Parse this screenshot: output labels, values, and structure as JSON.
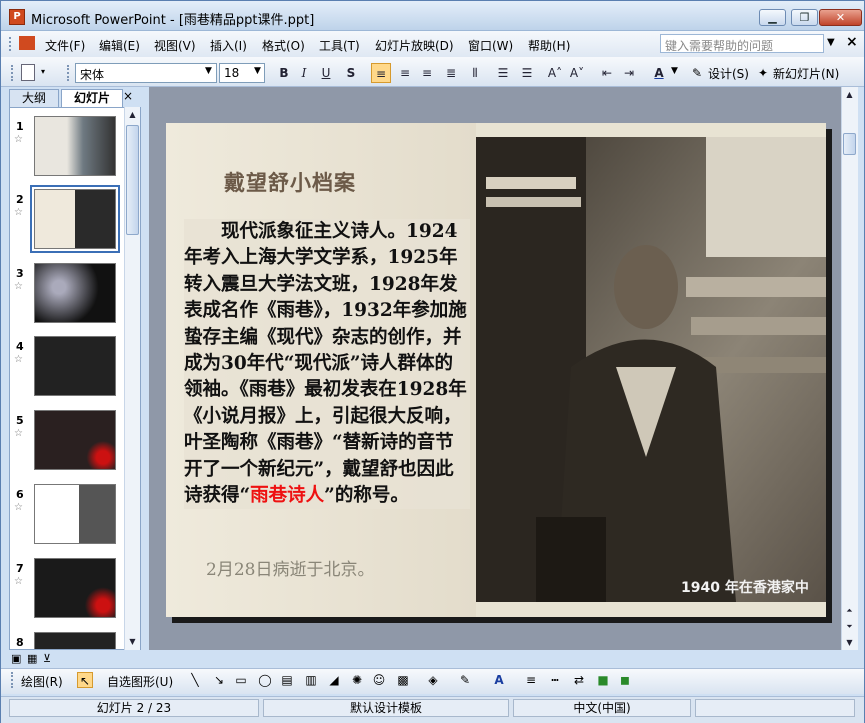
{
  "window": {
    "title": "Microsoft PowerPoint - [雨巷精品ppt课件.ppt]",
    "app_icon": "powerpoint-icon"
  },
  "menu": {
    "items": [
      "文件(F)",
      "编辑(E)",
      "视图(V)",
      "插入(I)",
      "格式(O)",
      "工具(T)",
      "幻灯片放映(D)",
      "窗口(W)",
      "帮助(H)"
    ],
    "help_placeholder": "键入需要帮助的问题"
  },
  "toolbar": {
    "font_name": "宋体",
    "font_size": "18",
    "bold": "B",
    "italic": "I",
    "underline": "U",
    "shadow": "S",
    "design_label": "设计(S)",
    "new_slide_label": "新幻灯片(N)"
  },
  "panel": {
    "tab_outline": "大纲",
    "tab_slides": "幻灯片",
    "close": "×",
    "slides": [
      {
        "num": "1"
      },
      {
        "num": "2"
      },
      {
        "num": "3"
      },
      {
        "num": "4"
      },
      {
        "num": "5"
      },
      {
        "num": "6"
      },
      {
        "num": "7"
      },
      {
        "num": "8"
      }
    ],
    "selected": 2
  },
  "slide": {
    "title": "戴望舒小档案",
    "body_before": "　　现代派象征主义诗人。1924年考入上海大学文学系，1925年转入震旦大学法文班，1928年发表成名作《雨巷》，1932年参加施蛰存主编《现代》杂志的创作，并成为30年代“现代派”诗人群体的领袖。《雨巷》最初发表在1928年《小说月报》上，引起很大反响，叶圣陶称《雨巷》“替新诗的音节开了一个新纪元”，戴望舒也因此诗获得“",
    "body_highlight": "雨巷诗人",
    "body_after": "”的称号。",
    "ghost_text": "2月28日病逝于北京。",
    "photo_caption": "1940 年在香港家中",
    "highlight_color": "#e11111"
  },
  "drawing_toolbar": {
    "draw_label": "绘图(R)",
    "autoshape_label": "自选图形(U)"
  },
  "status": {
    "slide_label": "幻灯片 2 / 23",
    "template": "默认设计模板",
    "language": "中文(中国)"
  }
}
